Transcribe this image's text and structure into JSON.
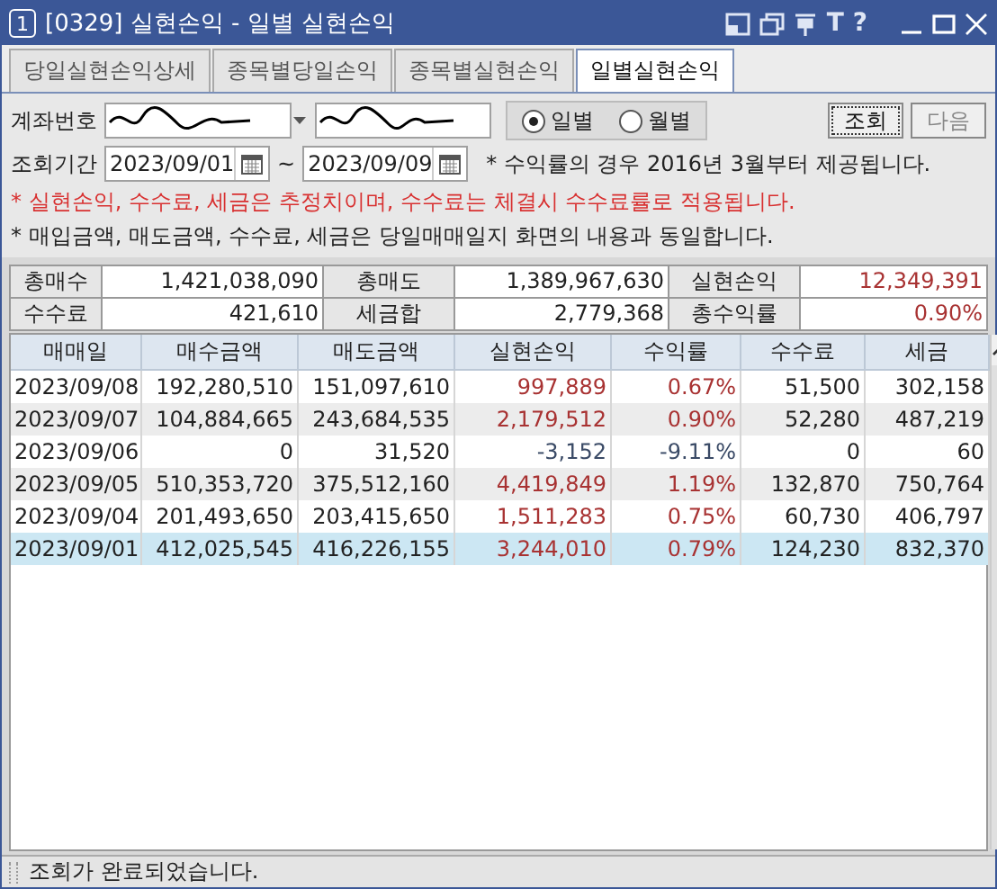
{
  "window": {
    "badge": "1",
    "title": "[0329] 실현손익 - 일별 실현손익",
    "tool_glyphs": [
      "T",
      "?"
    ]
  },
  "tabs": [
    {
      "label": "당일실현손익상세",
      "selected": false
    },
    {
      "label": "종목별당일손익",
      "selected": false
    },
    {
      "label": "종목별실현손익",
      "selected": false
    },
    {
      "label": "일별실현손익",
      "selected": true
    }
  ],
  "form": {
    "account_label": "계좌번호",
    "period_label": "조회기간",
    "date_from": "2023/09/01",
    "separator": "~",
    "date_to": "2023/09/09",
    "period_modes": [
      {
        "label": "일별",
        "selected": true
      },
      {
        "label": "월별",
        "selected": false
      }
    ],
    "buttons": [
      {
        "label": "조회",
        "disabled": false
      },
      {
        "label": "다음",
        "disabled": true
      }
    ],
    "note": "* 수익률의 경우 2016년 3월부터 제공됩니다.",
    "warnings": [
      {
        "text": "* 실현손익, 수수료, 세금은 추정치이며, 수수료는 체결시 수수료률로 적용됩니다.",
        "kind": "alert"
      },
      {
        "text": "* 매입금액, 매도금액, 수수료, 세금은 당일매매일지 화면의 내용과 동일합니다.",
        "kind": "info"
      }
    ]
  },
  "summary": [
    [
      {
        "label": "총매수",
        "value": "1,421,038,090",
        "color": "#222222"
      },
      {
        "label": "총매도",
        "value": "1,389,967,630",
        "color": "#222222"
      },
      {
        "label": "실현손익",
        "value": "12,349,391",
        "color": "#a83232"
      }
    ],
    [
      {
        "label": "수수료",
        "value": "421,610",
        "color": "#222222"
      },
      {
        "label": "세금합",
        "value": "2,779,368",
        "color": "#222222"
      },
      {
        "label": "총수익률",
        "value": "0.90%",
        "color": "#a83232"
      }
    ]
  ],
  "table": {
    "columns": [
      "매매일",
      "매수금액",
      "매도금액",
      "실현손익",
      "수익률",
      "수수료",
      "세금"
    ],
    "rows": [
      {
        "cells": [
          "2023/09/08",
          "192,280,510",
          "151,097,610",
          "997,889",
          "0.67%",
          "51,500",
          "302,158"
        ],
        "color": "#a83232",
        "selected": false
      },
      {
        "cells": [
          "2023/09/07",
          "104,884,665",
          "243,684,535",
          "2,179,512",
          "0.90%",
          "52,280",
          "487,219"
        ],
        "color": "#a83232",
        "selected": false
      },
      {
        "cells": [
          "2023/09/06",
          "0",
          "31,520",
          "-3,152",
          "-9.11%",
          "0",
          "60"
        ],
        "color": "#3a4a66",
        "selected": false
      },
      {
        "cells": [
          "2023/09/05",
          "510,353,720",
          "375,512,160",
          "4,419,849",
          "1.19%",
          "132,870",
          "750,764"
        ],
        "color": "#a83232",
        "selected": false
      },
      {
        "cells": [
          "2023/09/04",
          "201,493,650",
          "203,415,650",
          "1,511,283",
          "0.75%",
          "60,730",
          "406,797"
        ],
        "color": "#a83232",
        "selected": false
      },
      {
        "cells": [
          "2023/09/01",
          "412,025,545",
          "416,226,155",
          "3,244,010",
          "0.79%",
          "124,230",
          "832,370"
        ],
        "color": "#a83232",
        "selected": true
      }
    ]
  },
  "status_bar": {
    "message": "조회가 완료되었습니다."
  }
}
